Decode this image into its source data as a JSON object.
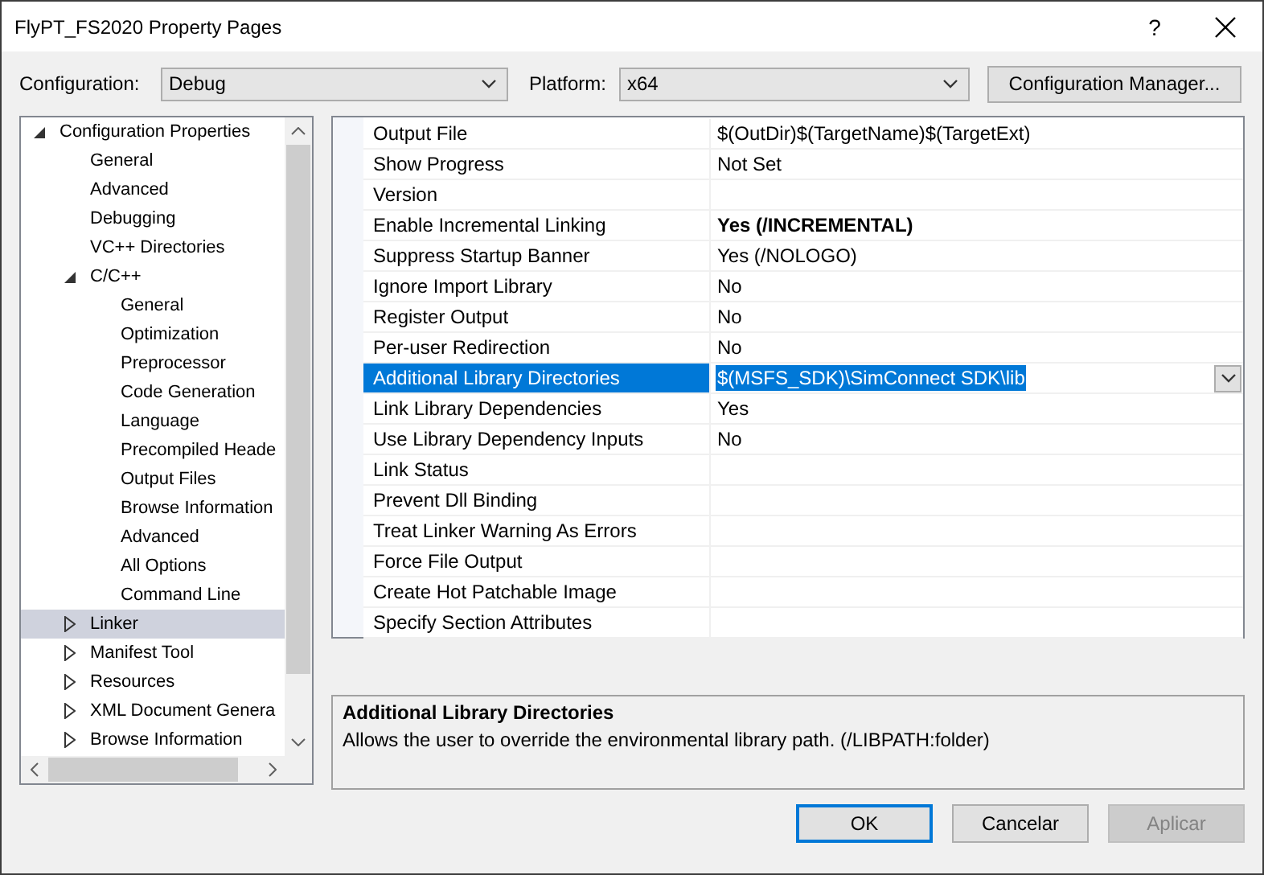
{
  "window": {
    "title": "FlyPT_FS2020 Property Pages",
    "help": "?"
  },
  "toolbar": {
    "configuration_label": "Configuration:",
    "configuration": "Debug",
    "platform_label": "Platform:",
    "platform": "x64",
    "manager_button": "Configuration Manager..."
  },
  "tree": [
    {
      "label": "Configuration Properties",
      "expanded": true,
      "selected": false,
      "children": [
        {
          "label": "General",
          "selected": false
        },
        {
          "label": "Advanced",
          "selected": false
        },
        {
          "label": "Debugging",
          "selected": false
        },
        {
          "label": "VC++ Directories",
          "selected": false
        },
        {
          "label": "C/C++",
          "expanded": true,
          "selected": false,
          "children": [
            {
              "label": "General",
              "selected": false
            },
            {
              "label": "Optimization",
              "selected": false
            },
            {
              "label": "Preprocessor",
              "selected": false
            },
            {
              "label": "Code Generation",
              "selected": false
            },
            {
              "label": "Language",
              "selected": false
            },
            {
              "label": "Precompiled Heade",
              "selected": false
            },
            {
              "label": "Output Files",
              "selected": false
            },
            {
              "label": "Browse Information",
              "selected": false
            },
            {
              "label": "Advanced",
              "selected": false
            },
            {
              "label": "All Options",
              "selected": false
            },
            {
              "label": "Command Line",
              "selected": false
            }
          ]
        },
        {
          "label": "Linker",
          "expanded": false,
          "selected": true
        },
        {
          "label": "Manifest Tool",
          "expanded": false,
          "selected": false
        },
        {
          "label": "Resources",
          "expanded": false,
          "selected": false
        },
        {
          "label": "XML Document Genera",
          "expanded": false,
          "selected": false
        },
        {
          "label": "Browse Information",
          "expanded": false,
          "selected": false
        }
      ]
    }
  ],
  "properties": [
    {
      "name": "Output File",
      "value": "$(OutDir)$(TargetName)$(TargetExt)",
      "bold": false,
      "selected": false
    },
    {
      "name": "Show Progress",
      "value": "Not Set",
      "bold": false,
      "selected": false
    },
    {
      "name": "Version",
      "selected": false
    },
    {
      "name": "Enable Incremental Linking",
      "value": "Yes (/INCREMENTAL)",
      "bold": true,
      "selected": false
    },
    {
      "name": "Suppress Startup Banner",
      "value": "Yes (/NOLOGO)",
      "bold": false,
      "selected": false
    },
    {
      "name": "Ignore Import Library",
      "value": "No",
      "bold": false,
      "selected": false
    },
    {
      "name": "Register Output",
      "value": "No",
      "bold": false,
      "selected": false
    },
    {
      "name": "Per-user Redirection",
      "value": "No",
      "bold": false,
      "selected": false
    },
    {
      "name": "Additional Library Directories",
      "value": "$(MSFS_SDK)\\SimConnect SDK\\lib",
      "bold": false,
      "selected": true
    },
    {
      "name": "Link Library Dependencies",
      "value": "Yes",
      "bold": false,
      "selected": false
    },
    {
      "name": "Use Library Dependency Inputs",
      "value": "No",
      "bold": false,
      "selected": false
    },
    {
      "name": "Link Status",
      "selected": false
    },
    {
      "name": "Prevent Dll Binding",
      "selected": false
    },
    {
      "name": "Treat Linker Warning As Errors",
      "selected": false
    },
    {
      "name": "Force File Output",
      "selected": false
    },
    {
      "name": "Create Hot Patchable Image",
      "selected": false
    },
    {
      "name": "Specify Section Attributes",
      "selected": false
    }
  ],
  "description": {
    "title": "Additional Library Directories",
    "text": "Allows the user to override the environmental library path. (/LIBPATH:folder)"
  },
  "buttons": [
    {
      "label": "OK",
      "default": true,
      "disabled": false
    },
    {
      "label": "Cancelar",
      "default": false,
      "disabled": false
    },
    {
      "label": "Aplicar",
      "default": false,
      "disabled": true
    }
  ]
}
